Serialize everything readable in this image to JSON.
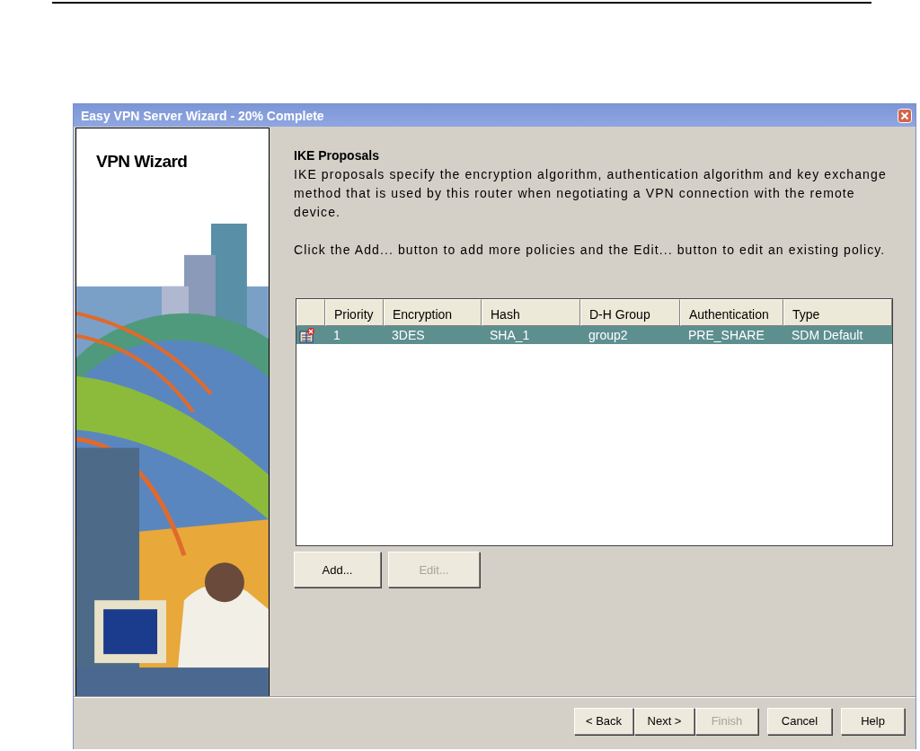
{
  "window": {
    "title": "Easy VPN Server Wizard - 20% Complete"
  },
  "sidebar": {
    "title": "VPN Wizard"
  },
  "content": {
    "heading": "IKE Proposals",
    "description": "IKE proposals specify the encryption algorithm, authentication algorithm and key exchange method that is used by this router when negotiating a VPN connection with the remote device.",
    "instruction": "Click the Add... button to add more policies and the Edit... button to edit an existing policy."
  },
  "table": {
    "columns": [
      "Priority",
      "Encryption",
      "Hash",
      "D-H Group",
      "Authentication",
      "Type"
    ],
    "rows": [
      {
        "selected": true,
        "cells": [
          "1",
          "3DES",
          "SHA_1",
          "group2",
          "PRE_SHARE",
          "SDM Default"
        ]
      }
    ]
  },
  "table_buttons": [
    {
      "label": "Add...",
      "disabled": false
    },
    {
      "label": "Edit...",
      "disabled": true
    }
  ],
  "nav_buttons": [
    {
      "label": "< Back",
      "disabled": false
    },
    {
      "label": "Next >",
      "disabled": false
    },
    {
      "label": "Finish",
      "disabled": true
    },
    {
      "label": "Cancel",
      "disabled": false
    },
    {
      "label": "Help",
      "disabled": false
    }
  ]
}
